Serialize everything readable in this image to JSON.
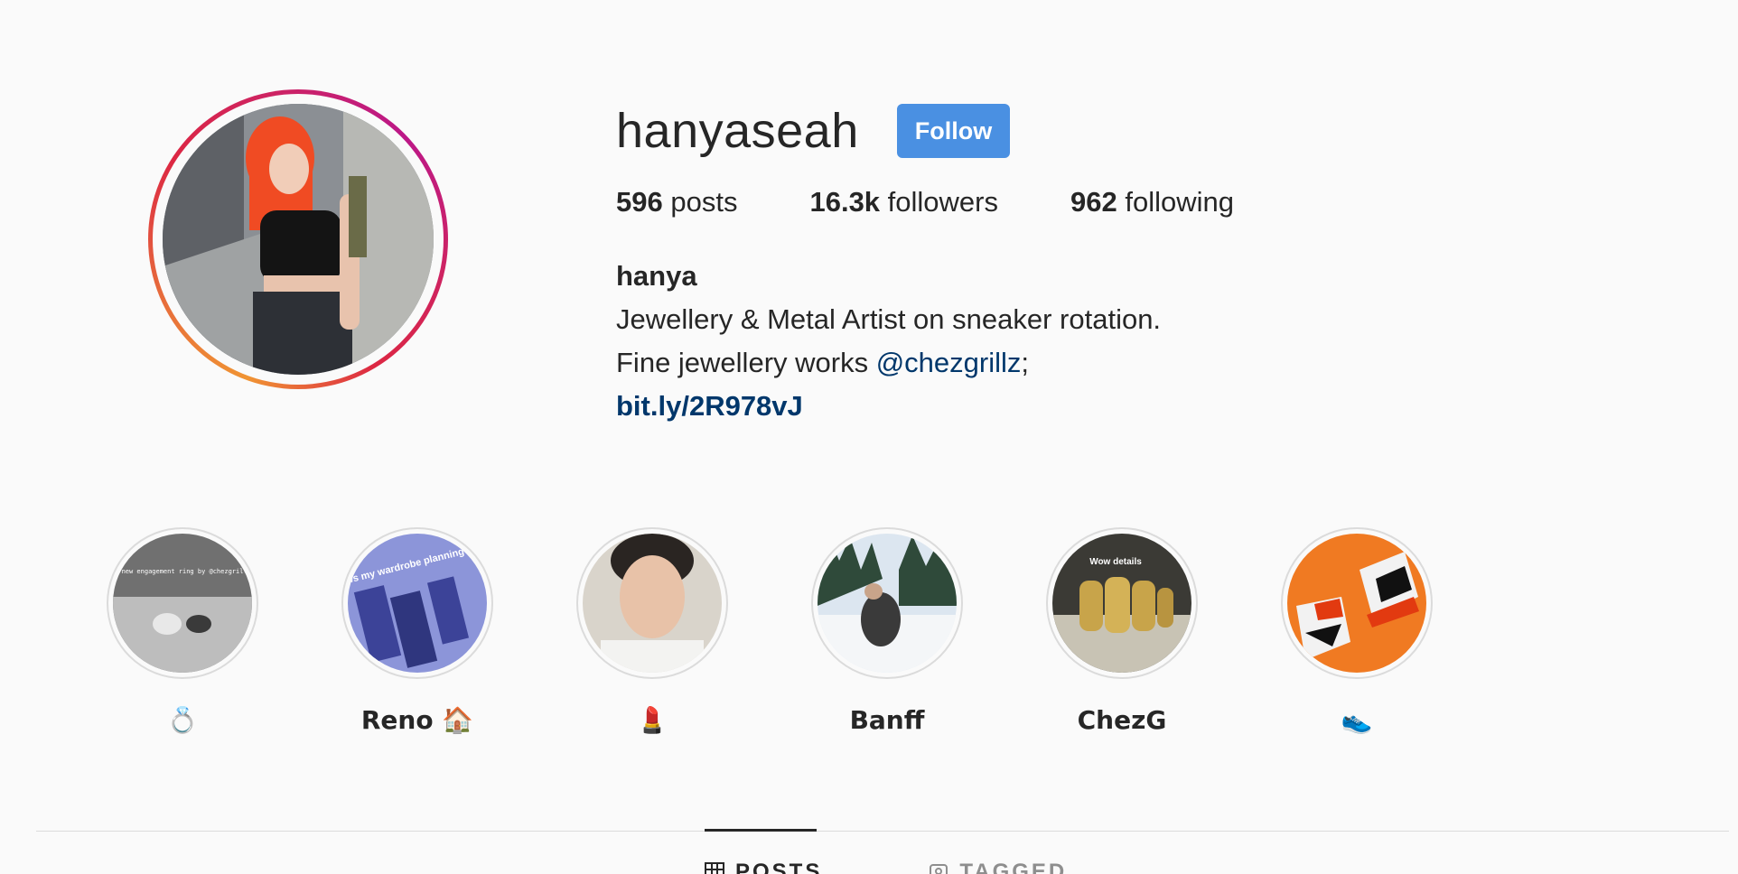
{
  "profile": {
    "username": "hanyaseah",
    "follow_label": "Follow",
    "stats": {
      "posts_count": "596",
      "posts_label": "posts",
      "followers_count": "16.3k",
      "followers_label": "followers",
      "following_count": "962",
      "following_label": "following"
    },
    "bio": {
      "name": "hanya",
      "line1": "Jewellery & Metal Artist on sneaker rotation.",
      "line2_prefix": "Fine jewellery works ",
      "line2_mention": "@chezgrillz",
      "line2_suffix": ";",
      "link": "bit.ly/2R978vJ"
    }
  },
  "highlights": [
    {
      "label": "💍",
      "cover_text": "A new engagement ring by @chezgrillz"
    },
    {
      "label": "Reno 🏠",
      "cover_text": "Hows my wardrobe planning?"
    },
    {
      "label": "💄",
      "cover_text": ""
    },
    {
      "label": "Banff",
      "cover_text": ""
    },
    {
      "label": "ChezG",
      "cover_text": "Wow details"
    },
    {
      "label": "👟",
      "cover_text": ""
    }
  ],
  "tabs": [
    {
      "label": "POSTS",
      "icon": "grid-icon",
      "active": true
    },
    {
      "label": "TAGGED",
      "icon": "tag-icon",
      "active": false
    }
  ],
  "colors": {
    "follow_button": "#4a90e2",
    "link": "#00376b",
    "background": "#fafafa"
  }
}
